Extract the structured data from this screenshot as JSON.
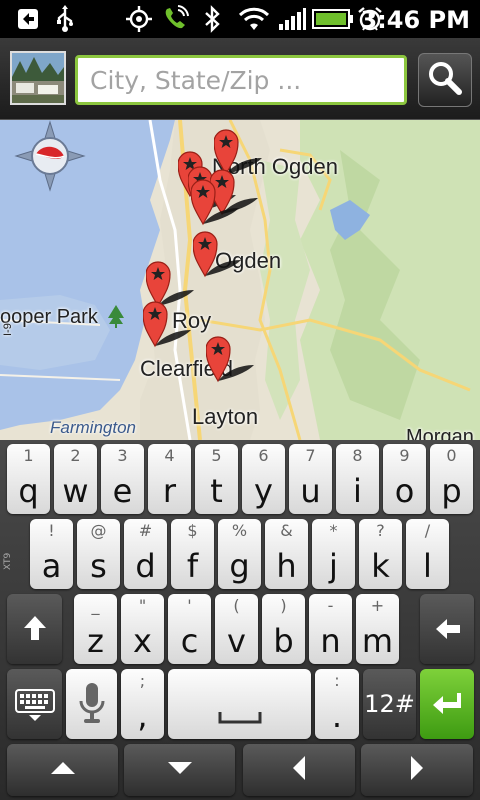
{
  "status_bar": {
    "time": "3:46 PM",
    "icons": [
      "usb-debug-icon",
      "usb-icon",
      "gps-icon",
      "phone-icon",
      "bluetooth-icon",
      "wifi-icon",
      "signal-icon",
      "battery-icon",
      "alarm-icon"
    ]
  },
  "search": {
    "placeholder": "City, State/Zip ...",
    "button_icon": "search-icon",
    "accent_color": "#8cc63f"
  },
  "map": {
    "labels": {
      "north_ogden": "North Ogden",
      "ogden": "Ogden",
      "roy": "Roy",
      "clearfield": "Clearfield",
      "layton": "Layton",
      "hooper_park": "ooper Park",
      "farmington": "Farmington",
      "morgan": "Morgan",
      "road": "I-9"
    },
    "pin_count": 9
  },
  "keyboard": {
    "row1": [
      {
        "top": "1",
        "main": "q"
      },
      {
        "top": "2",
        "main": "w"
      },
      {
        "top": "3",
        "main": "e"
      },
      {
        "top": "4",
        "main": "r"
      },
      {
        "top": "5",
        "main": "t"
      },
      {
        "top": "6",
        "main": "y"
      },
      {
        "top": "7",
        "main": "u"
      },
      {
        "top": "8",
        "main": "i"
      },
      {
        "top": "9",
        "main": "o"
      },
      {
        "top": "0",
        "main": "p"
      }
    ],
    "row2": [
      {
        "top": "!",
        "main": "a"
      },
      {
        "top": "@",
        "main": "s"
      },
      {
        "top": "#",
        "main": "d"
      },
      {
        "top": "$",
        "main": "f"
      },
      {
        "top": "%",
        "main": "g"
      },
      {
        "top": "&",
        "main": "h"
      },
      {
        "top": "*",
        "main": "j"
      },
      {
        "top": "?",
        "main": "k"
      },
      {
        "top": "/",
        "main": "l"
      }
    ],
    "row3": [
      {
        "top": "_",
        "main": "z"
      },
      {
        "top": "\"",
        "main": "x"
      },
      {
        "top": "'",
        "main": "c"
      },
      {
        "top": "(",
        "main": "v"
      },
      {
        "top": ")",
        "main": "b"
      },
      {
        "top": "-",
        "main": "n"
      },
      {
        "top": "+",
        "main": "m"
      }
    ],
    "comma": {
      "top": ";",
      "main": ","
    },
    "period": {
      "top": ":",
      "main": "."
    },
    "symbols_label": "12#",
    "xt9_label": "XT9"
  }
}
